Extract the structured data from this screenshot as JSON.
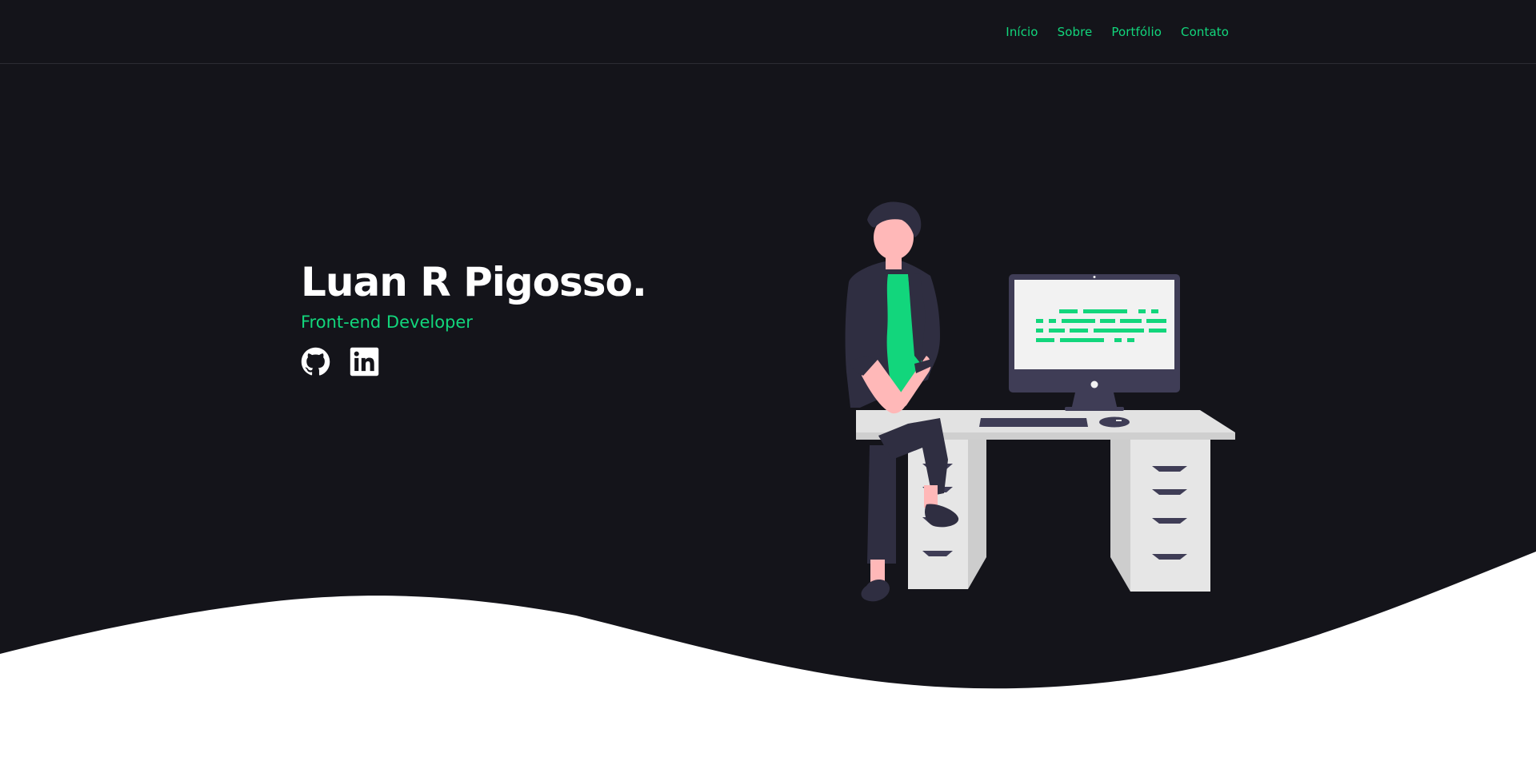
{
  "nav": {
    "items": [
      "Início",
      "Sobre",
      "Portfólio",
      "Contato"
    ]
  },
  "hero": {
    "name": "Luan R Pigosso.",
    "role": "Front-end Developer"
  },
  "socials": {
    "github_icon": "github-icon",
    "linkedin_icon": "linkedin-icon"
  },
  "colors": {
    "background": "#14141a",
    "accent": "#12d67c",
    "text": "#ffffff",
    "wave": "#ffffff"
  }
}
